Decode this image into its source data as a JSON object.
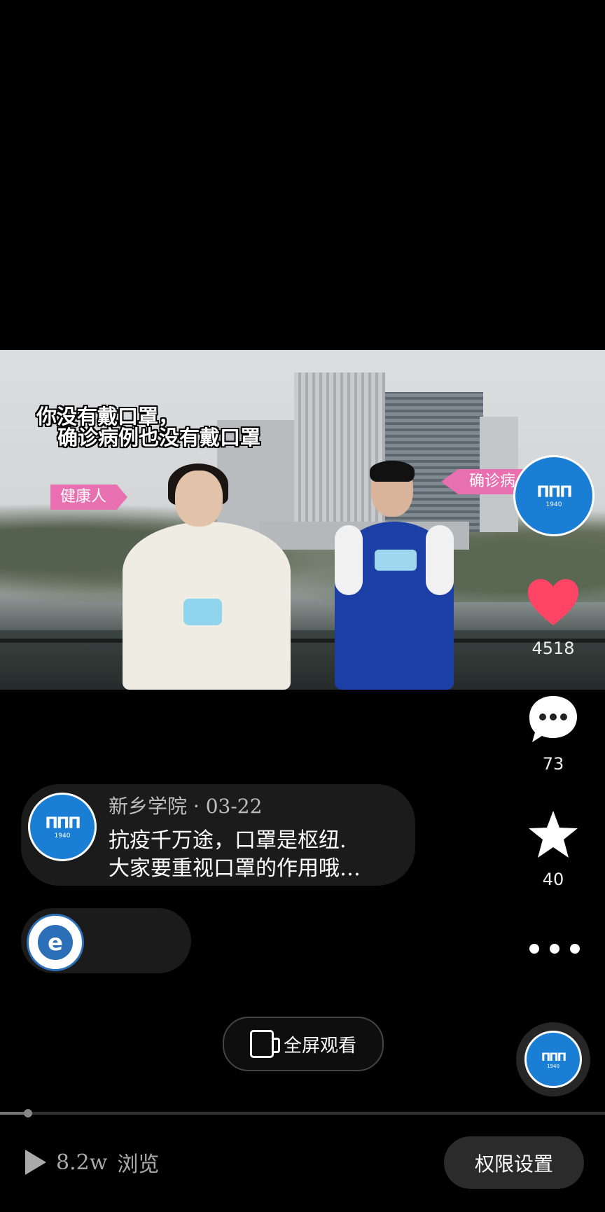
{
  "video": {
    "subtitle_line1": "你没有戴口罩，",
    "subtitle_line2": "确诊病例也没有戴口罩",
    "tag_left": "健康人",
    "tag_right": "确诊病",
    "logo_mark": "ΠΠΠ",
    "logo_year": "1940"
  },
  "side_actions": {
    "like_count": "4518",
    "comment_count": "73",
    "favorite_count": "40",
    "like_color": "#ff4466"
  },
  "post": {
    "meta": "新乡学院 · 03-22",
    "text_line1": "抗疫千万途，口罩是枢纽.",
    "text_line2": "大家要重视口罩的作用哦…",
    "logo_mark": "ΠΠΠ",
    "logo_year": "1940"
  },
  "second_account": {
    "logo_letter": "e"
  },
  "fullscreen_button": {
    "label": "全屏观看"
  },
  "music_disc": {
    "logo_mark": "ΠΠΠ",
    "logo_year": "1940"
  },
  "footer": {
    "view_count": "8.2w",
    "view_label": "浏览",
    "permission_button": "权限设置"
  }
}
